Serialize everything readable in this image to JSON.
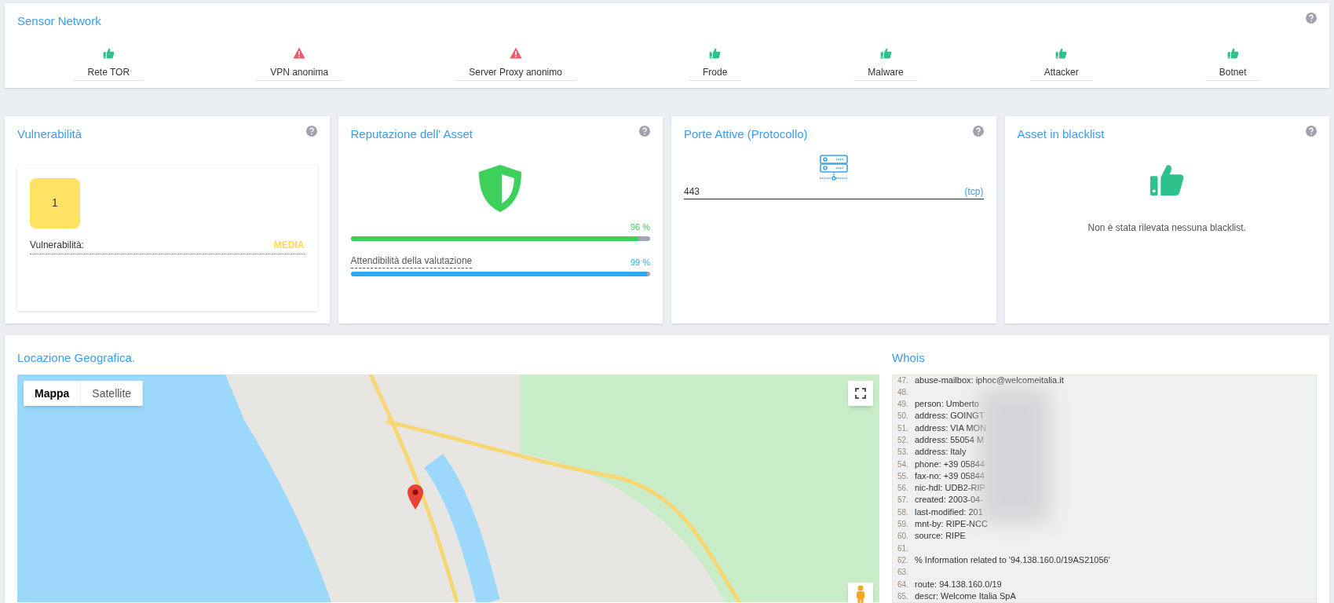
{
  "sensor_network": {
    "title": "Sensor Network",
    "items": [
      {
        "label": "Rete TOR",
        "kind": "ok"
      },
      {
        "label": "VPN anonima",
        "kind": "warning"
      },
      {
        "label": "Server Proxy anonimo",
        "kind": "warning"
      },
      {
        "label": "Frode",
        "kind": "ok"
      },
      {
        "label": "Malware",
        "kind": "ok"
      },
      {
        "label": "Attacker",
        "kind": "ok"
      },
      {
        "label": "Botnet",
        "kind": "ok"
      }
    ]
  },
  "vulnerability": {
    "title": "Vulnerabilità",
    "count": "1",
    "label": "Vulnerabilità:",
    "severity": "MEDIA"
  },
  "reputation": {
    "title": "Reputazione dell' Asset",
    "score": {
      "reading": "96 %",
      "level": 0.96
    },
    "reliability": {
      "label": "Attendibilità della valutazione",
      "reading": "99 %",
      "level": 0.99
    }
  },
  "ports": {
    "title": "Porte Attive (Protocollo)",
    "items": [
      {
        "port": "443",
        "protocol": "(tcp)"
      }
    ]
  },
  "blacklist": {
    "title": "Asset in blacklist",
    "message": "Non è stata rilevata nessuna blacklist."
  },
  "location": {
    "title": "Locazione Geografica.",
    "map_types": [
      {
        "label": "Mappa",
        "selected": true
      },
      {
        "label": "Satellite",
        "selected": false
      }
    ]
  },
  "whois": {
    "title": "Whois",
    "lines": [
      {
        "number": "47.",
        "text": "abuse-mailbox: iphoc@welcomeitalia.it"
      },
      {
        "number": "48."
      },
      {
        "number": "49.",
        "text": "person: Umberto"
      },
      {
        "number": "50.",
        "text": "address: GOINGT"
      },
      {
        "number": "51.",
        "text": "address: VIA MON"
      },
      {
        "number": "52.",
        "text": "address: 55054 M"
      },
      {
        "number": "53.",
        "text": "address: Italy"
      },
      {
        "number": "54.",
        "text": "phone: +39 05844"
      },
      {
        "number": "55.",
        "text": "fax-no: +39 05844"
      },
      {
        "number": "56.",
        "text": "nic-hdl: UDB2-RIP"
      },
      {
        "number": "57.",
        "text": "created: 2003-04-"
      },
      {
        "number": "58.",
        "text": "last-modified: 201"
      },
      {
        "number": "59.",
        "text": "mnt-by: RIPE-NCC"
      },
      {
        "number": "60.",
        "text": "source: RIPE"
      },
      {
        "number": "61."
      },
      {
        "number": "62.",
        "text": "% Information related to '94.138.160.0/19AS21056'"
      },
      {
        "number": "63."
      },
      {
        "number": "64.",
        "text": "route: 94.138.160.0/19"
      },
      {
        "number": "65.",
        "text": "descr: Welcome Italia SpA"
      }
    ]
  }
}
